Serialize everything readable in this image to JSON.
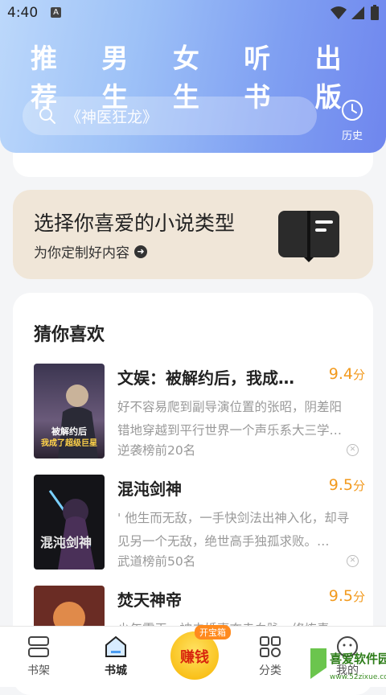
{
  "status": {
    "time": "4:40",
    "notif": "A"
  },
  "tabs": [
    {
      "label": "推荐",
      "active": true
    },
    {
      "label": "男生"
    },
    {
      "label": "女生"
    },
    {
      "label": "听书"
    },
    {
      "label": "出版"
    }
  ],
  "search": {
    "placeholder": "《神医狂龙》",
    "history_label": "历史"
  },
  "banner": {
    "title": "选择你喜爱的小说类型",
    "subtitle": "为你定制好内容"
  },
  "guess": {
    "title": "猜你喜欢",
    "books": [
      {
        "name": "文娱：被解约后，我成…",
        "score": "9.4",
        "unit": "分",
        "desc": "好不容易爬到副导演位置的张昭，阴差阳错地穿越到平行世界一个声乐系大三学…",
        "rank": "逆袭榜前20名",
        "cover_text": "被解约后 我成了超级巨星"
      },
      {
        "name": "混沌剑神",
        "score": "9.5",
        "unit": "分",
        "desc": "' 他生而无敌，一手快剑法出神入化，却寻见另一个无敌，绝世高手独孤求败。…",
        "rank": "武道榜前50名",
        "cover_text": "混沌剑神"
      },
      {
        "name": "焚天神帝",
        "score": "9.5",
        "unit": "分",
        "desc": "少年雷天，被未婚妻夺走血脉，修炼毒…",
        "rank": "",
        "cover_text": ""
      }
    ]
  },
  "nav": {
    "items": [
      {
        "label": "书架"
      },
      {
        "label": "书城"
      },
      {
        "label": "分类"
      },
      {
        "label": "我的"
      }
    ],
    "earn_label": "赚钱",
    "earn_badge": "开宝箱"
  },
  "watermark": {
    "text": "喜爱软件园",
    "url": "www.52zixue.com"
  }
}
